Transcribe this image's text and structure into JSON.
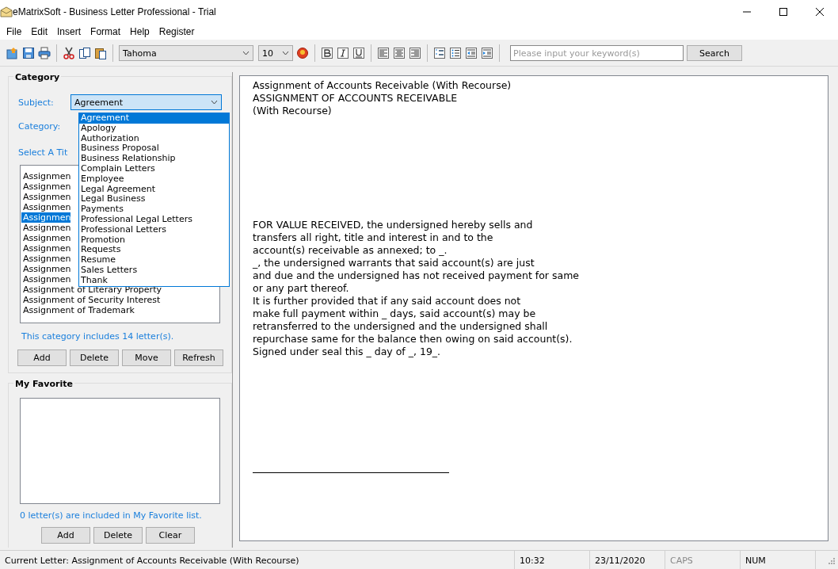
{
  "window": {
    "title": "eMatrixSoft - Business Letter Professional - Trial"
  },
  "menu": [
    "File",
    "Edit",
    "Insert",
    "Format",
    "Help",
    "Register"
  ],
  "toolbar": {
    "font": "Tahoma",
    "size": "10",
    "search": {
      "placeholder": "Please input your keyword(s)",
      "button": "Search"
    }
  },
  "category": {
    "title": "Category",
    "subject_label": "Subject:",
    "subject_value": "Agreement",
    "category_label": "Category:",
    "select_label": "Select A Tit",
    "dropdown": [
      {
        "label": "Agreement",
        "selected": true
      },
      {
        "label": "Apology",
        "selected": false
      },
      {
        "label": "Authorization",
        "selected": false
      },
      {
        "label": "Business Proposal",
        "selected": false
      },
      {
        "label": "Business Relationship",
        "selected": false
      },
      {
        "label": "Complain Letters",
        "selected": false
      },
      {
        "label": "Employee",
        "selected": false
      },
      {
        "label": "Legal Agreement",
        "selected": false
      },
      {
        "label": "Legal Business",
        "selected": false
      },
      {
        "label": "Payments",
        "selected": false
      },
      {
        "label": "Professional Legal Letters",
        "selected": false
      },
      {
        "label": "Professional Letters",
        "selected": false
      },
      {
        "label": "Promotion",
        "selected": false
      },
      {
        "label": "Requests",
        "selected": false
      },
      {
        "label": "Resume",
        "selected": false
      },
      {
        "label": "Sales Letters",
        "selected": false
      },
      {
        "label": "Thank",
        "selected": false
      }
    ],
    "titles": [
      {
        "label": "Assignmen",
        "selected": false
      },
      {
        "label": "Assignmen",
        "selected": false
      },
      {
        "label": "Assignmen",
        "selected": false
      },
      {
        "label": "Assignmen",
        "selected": false
      },
      {
        "label": "Assignmen",
        "selected": true
      },
      {
        "label": "Assignmen",
        "selected": false
      },
      {
        "label": "Assignmen",
        "selected": false
      },
      {
        "label": "Assignmen",
        "selected": false
      },
      {
        "label": "Assignmen",
        "selected": false
      },
      {
        "label": "Assignmen",
        "selected": false
      },
      {
        "label": "Assignmen",
        "selected": false
      },
      {
        "label": "Assignment of Literary Property",
        "selected": false
      },
      {
        "label": "Assignment of Security Interest",
        "selected": false
      },
      {
        "label": "Assignment of Trademark",
        "selected": false
      }
    ],
    "count": "This category includes 14 letter(s).",
    "buttons": [
      "Add",
      "Delete",
      "Move",
      "Refresh"
    ]
  },
  "favorite": {
    "title": "My Favorite",
    "count": "0 letter(s) are included in My Favorite list.",
    "buttons": [
      "Add",
      "Delete",
      "Clear"
    ]
  },
  "document": [
    {
      "kind": "heading",
      "lines": [
        "Assignment of Accounts Receivable (With Recourse)",
        "ASSIGNMENT OF ACCOUNTS RECEIVABLE",
        "(With Recourse)"
      ]
    },
    {
      "kind": "body",
      "lines": [
        "FOR VALUE RECEIVED, the undersigned hereby sells and",
        "transfers all right, title and interest in and to the",
        "account(s) receivable as annexed; to _.",
        "_, the undersigned warrants that said account(s) are just",
        "and due and the undersigned has not received payment for same",
        "or any part thereof.",
        "It is further provided that if any said account does not",
        "make full payment within _ days, said account(s) may be",
        "retransferred to the undersigned and the undersigned shall",
        "repurchase same for the balance then owing on said account(s).",
        "Signed under seal this _ day of _, 19_."
      ]
    },
    {
      "kind": "signature_line"
    }
  ],
  "status_bar": {
    "current": "Current Letter: Assignment of Accounts Receivable (With Recourse)",
    "time": "10:32",
    "date": "23/11/2020",
    "indicators": [
      {
        "label": "CAPS",
        "on": false
      },
      {
        "label": "NUM",
        "on": true
      }
    ]
  }
}
